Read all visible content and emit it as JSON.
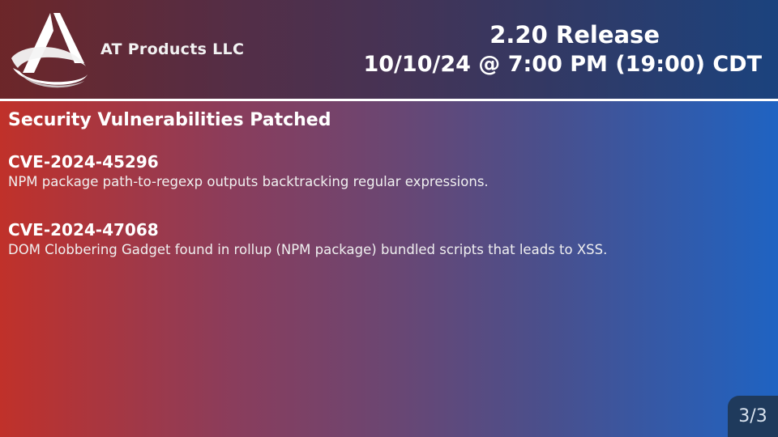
{
  "header": {
    "company_name": "AT Products LLC",
    "release_title": "2.20 Release",
    "release_date": "10/10/24 @ 7:00 PM (19:00) CDT",
    "logo_icon": "at-products-logo"
  },
  "main": {
    "section_title": "Security Vulnerabilities Patched",
    "cves": [
      {
        "id": "CVE-2024-45296",
        "description": "NPM package path-to-regexp outputs backtracking regular expressions."
      },
      {
        "id": "CVE-2024-47068",
        "description": "DOM Clobbering Gadget found in rollup (NPM package) bundled scripts that leads to XSS."
      }
    ]
  },
  "footer": {
    "page_indicator": "3/3"
  },
  "colors": {
    "gradient_left": "#c0312a",
    "gradient_right": "#1f63c2",
    "divider": "#ffffff",
    "page_badge": "#1f3a5c"
  }
}
